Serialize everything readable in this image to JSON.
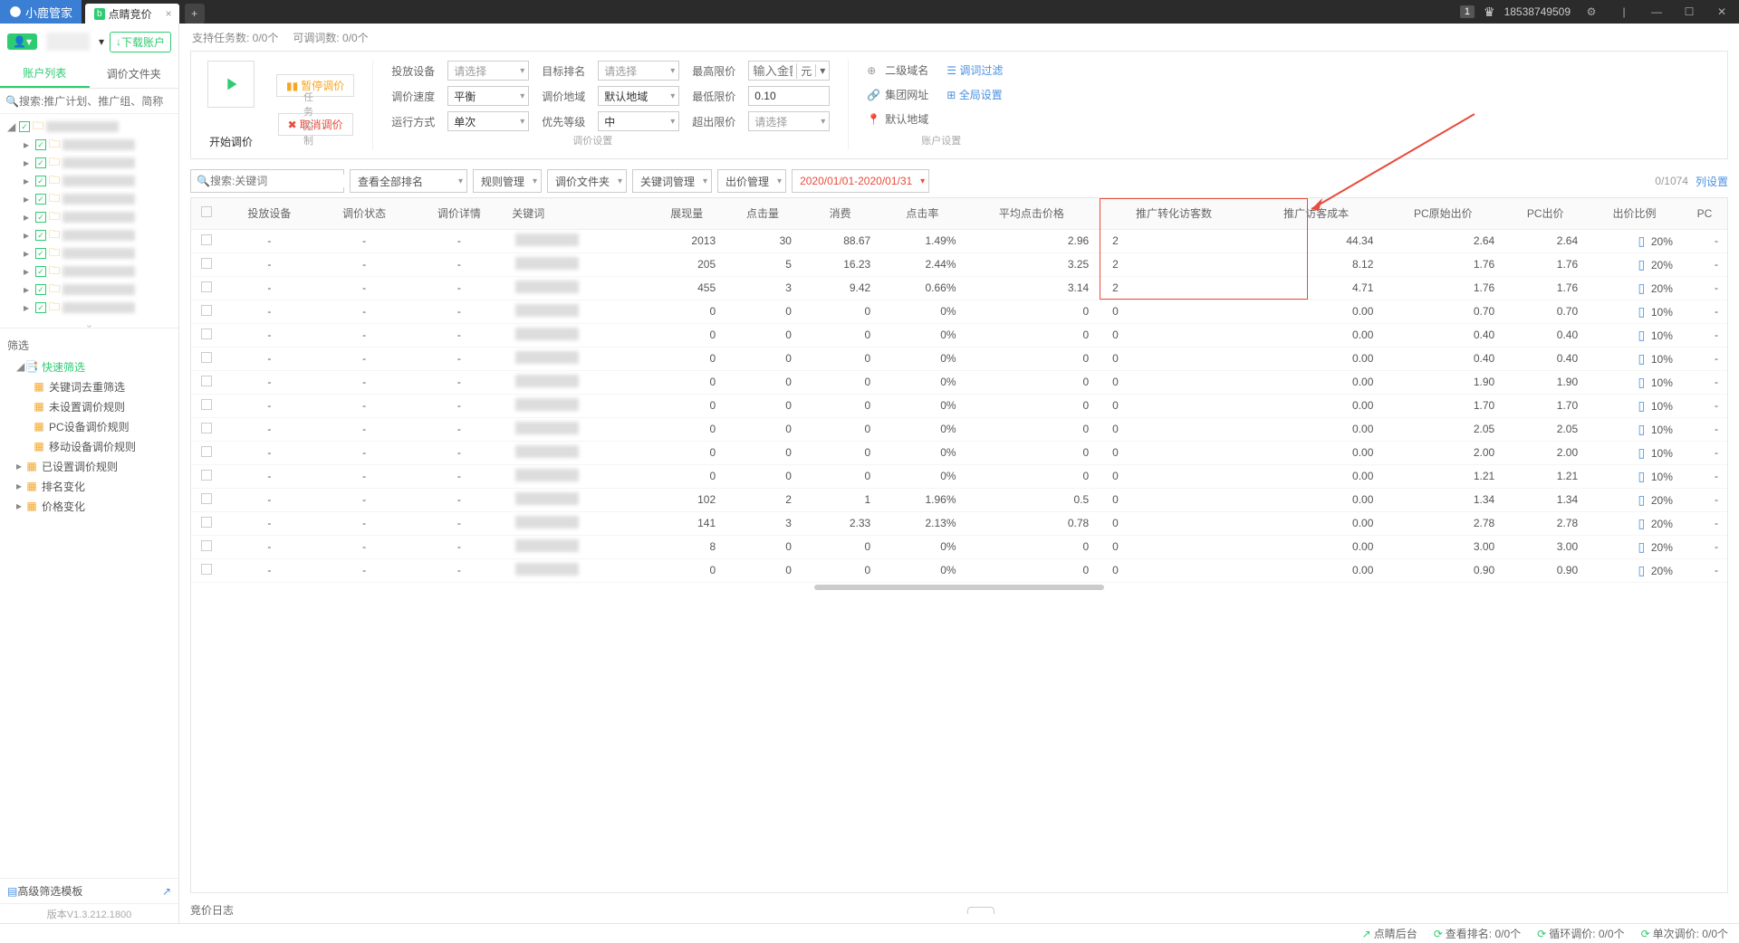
{
  "tabbar": {
    "logo": "小鹿管家",
    "active_tab": "点睛竞价",
    "badge": "b",
    "account": "18538749509",
    "notif": "1"
  },
  "side": {
    "download_btn": "下载账户",
    "tabs": {
      "accounts": "账户列表",
      "files": "调价文件夹"
    },
    "search_ph": "搜索:推广计划、推广组、简称",
    "filter_header": "筛选",
    "quick": "快速筛选",
    "f1": "关键词去重筛选",
    "f2": "未设置调价规则",
    "f3": "PC设备调价规则",
    "f4": "移动设备调价规则",
    "f5": "已设置调价规则",
    "f6": "排名变化",
    "f7": "价格变化",
    "advfilter": "高级筛选模板"
  },
  "info": {
    "tasks": "支持任务数: 0/0个",
    "words": "可调词数: 0/0个"
  },
  "ctrl": {
    "start": "开始调价",
    "pause": "暂停调价",
    "cancel": "取消调价",
    "task_lbl": "任务控制",
    "f": {
      "tfsb": "投放设备",
      "tfsb_v": "请选择",
      "tjsd": "调价速度",
      "tjsd_v": "平衡",
      "yxfs": "运行方式",
      "yxfs_v": "单次",
      "mbpm": "目标排名",
      "mbpm_v": "请选择",
      "tjdy": "调价地域",
      "tjdy_v": "默认地域",
      "yxdj": "优先等级",
      "yxdj_v": "中",
      "zgxj": "最高限价",
      "zgxj_v": "输入金额",
      "zgxj_u": "元",
      "zdxj": "最低限价",
      "zdxj_v": "0.10",
      "ccxj": "超出限价",
      "ccxj_v": "请选择"
    },
    "set_lbl": "调价设置",
    "acct": {
      "ejym": "二级域名",
      "tcgl": "调词过滤",
      "jtwz": "集团网址",
      "qjsz": "全局设置",
      "mrdy": "默认地域",
      "acct_lbl": "账户设置"
    }
  },
  "bar": {
    "search_ph": "搜索:关键词",
    "d1": "查看全部排名",
    "d2": "规则管理",
    "d3": "调价文件夹",
    "d4": "关键词管理",
    "d5": "出价管理",
    "date": "2020/01/01-2020/01/31",
    "count": "0/1074",
    "colset": "列设置"
  },
  "cols": {
    "c1": "投放设备",
    "c2": "调价状态",
    "c3": "调价详情",
    "c4": "关键词",
    "c5": "展现量",
    "c6": "点击量",
    "c7": "消费",
    "c8": "点击率",
    "c9": "平均点击价格",
    "c10": "推广转化访客数",
    "c11": "推广访客成本",
    "c12": "PC原始出价",
    "c13": "PC出价",
    "c14": "出价比例",
    "c15": "PC"
  },
  "rows": [
    {
      "zx": "2013",
      "dj": "30",
      "xf": "88.67",
      "djl": "1.49%",
      "pj": "2.96",
      "zh": "2",
      "cb": "44.34",
      "ys": "2.64",
      "pc": "2.64",
      "bl": "20%"
    },
    {
      "zx": "205",
      "dj": "5",
      "xf": "16.23",
      "djl": "2.44%",
      "pj": "3.25",
      "zh": "2",
      "cb": "8.12",
      "ys": "1.76",
      "pc": "1.76",
      "bl": "20%"
    },
    {
      "zx": "455",
      "dj": "3",
      "xf": "9.42",
      "djl": "0.66%",
      "pj": "3.14",
      "zh": "2",
      "cb": "4.71",
      "ys": "1.76",
      "pc": "1.76",
      "bl": "20%"
    },
    {
      "zx": "0",
      "dj": "0",
      "xf": "0",
      "djl": "0%",
      "pj": "0",
      "zh": "0",
      "cb": "0.00",
      "ys": "0.70",
      "pc": "0.70",
      "bl": "10%"
    },
    {
      "zx": "0",
      "dj": "0",
      "xf": "0",
      "djl": "0%",
      "pj": "0",
      "zh": "0",
      "cb": "0.00",
      "ys": "0.40",
      "pc": "0.40",
      "bl": "10%"
    },
    {
      "zx": "0",
      "dj": "0",
      "xf": "0",
      "djl": "0%",
      "pj": "0",
      "zh": "0",
      "cb": "0.00",
      "ys": "0.40",
      "pc": "0.40",
      "bl": "10%"
    },
    {
      "zx": "0",
      "dj": "0",
      "xf": "0",
      "djl": "0%",
      "pj": "0",
      "zh": "0",
      "cb": "0.00",
      "ys": "1.90",
      "pc": "1.90",
      "bl": "10%"
    },
    {
      "zx": "0",
      "dj": "0",
      "xf": "0",
      "djl": "0%",
      "pj": "0",
      "zh": "0",
      "cb": "0.00",
      "ys": "1.70",
      "pc": "1.70",
      "bl": "10%"
    },
    {
      "zx": "0",
      "dj": "0",
      "xf": "0",
      "djl": "0%",
      "pj": "0",
      "zh": "0",
      "cb": "0.00",
      "ys": "2.05",
      "pc": "2.05",
      "bl": "10%"
    },
    {
      "zx": "0",
      "dj": "0",
      "xf": "0",
      "djl": "0%",
      "pj": "0",
      "zh": "0",
      "cb": "0.00",
      "ys": "2.00",
      "pc": "2.00",
      "bl": "10%"
    },
    {
      "zx": "0",
      "dj": "0",
      "xf": "0",
      "djl": "0%",
      "pj": "0",
      "zh": "0",
      "cb": "0.00",
      "ys": "1.21",
      "pc": "1.21",
      "bl": "10%"
    },
    {
      "zx": "102",
      "dj": "2",
      "xf": "1",
      "djl": "1.96%",
      "pj": "0.5",
      "zh": "0",
      "cb": "0.00",
      "ys": "1.34",
      "pc": "1.34",
      "bl": "20%"
    },
    {
      "zx": "141",
      "dj": "3",
      "xf": "2.33",
      "djl": "2.13%",
      "pj": "0.78",
      "zh": "0",
      "cb": "0.00",
      "ys": "2.78",
      "pc": "2.78",
      "bl": "20%"
    },
    {
      "zx": "8",
      "dj": "0",
      "xf": "0",
      "djl": "0%",
      "pj": "0",
      "zh": "0",
      "cb": "0.00",
      "ys": "3.00",
      "pc": "3.00",
      "bl": "20%"
    },
    {
      "zx": "0",
      "dj": "0",
      "xf": "0",
      "djl": "0%",
      "pj": "0",
      "zh": "0",
      "cb": "0.00",
      "ys": "0.90",
      "pc": "0.90",
      "bl": "20%"
    }
  ],
  "log": "竞价日志",
  "ver": "版本V1.3.212.1800",
  "status": {
    "djht": "点睛后台",
    "ckpm": "查看排名: 0/0个",
    "xhtj": "循环调价: 0/0个",
    "dctj": "单次调价: 0/0个"
  }
}
